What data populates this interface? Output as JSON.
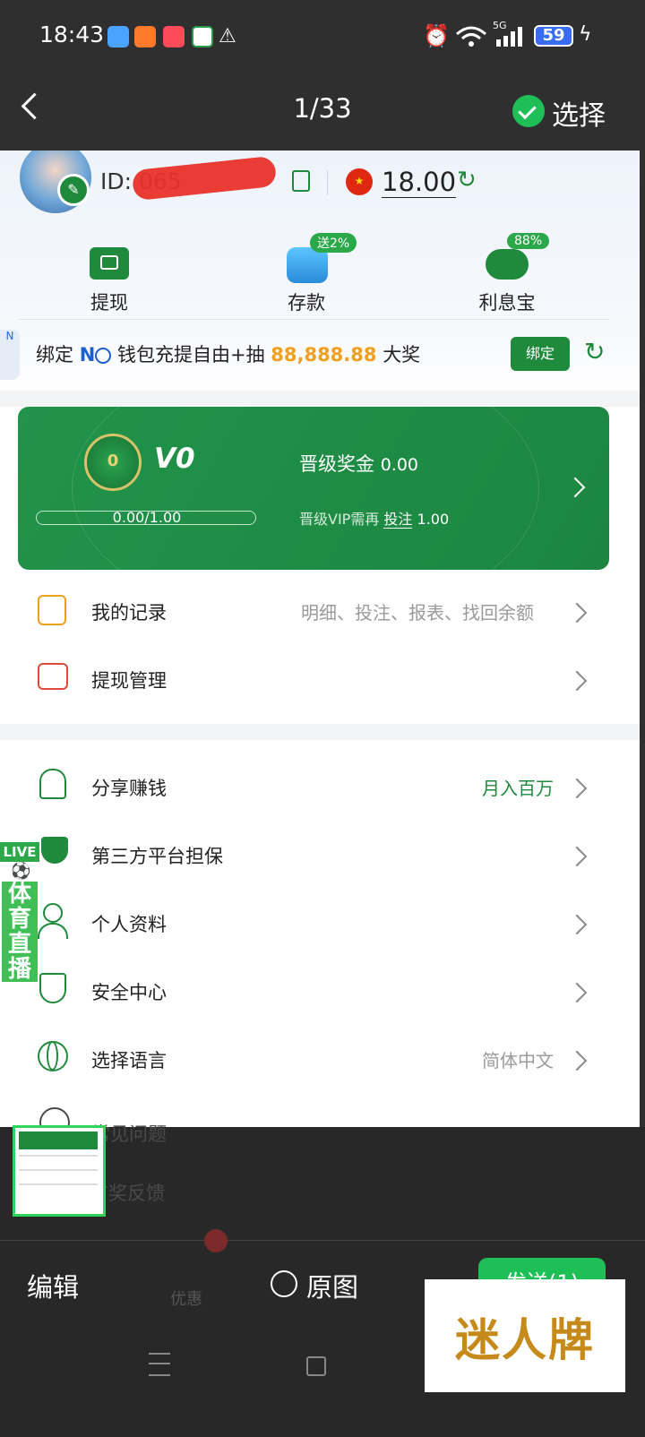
{
  "status": {
    "time": "18:43",
    "signal": "5G",
    "battery": "59"
  },
  "topbar": {
    "counter": "1/33",
    "select_label": "选择"
  },
  "profile": {
    "id_suffix": "ID: 065",
    "balance": "18.00"
  },
  "quick_actions": [
    {
      "label": "提现",
      "badge": ""
    },
    {
      "label": "存款",
      "badge": "送2%"
    },
    {
      "label": "利息宝",
      "badge": "88%"
    }
  ],
  "bind_banner": {
    "text_prefix": "绑定",
    "brand": "N",
    "text_mid": "钱包充提自由+抽",
    "amount": "88,888.88",
    "text_suffix": "大奖",
    "button": "绑定",
    "side_tag": "N"
  },
  "vip_card": {
    "level_badge": "0",
    "level": "V0",
    "progress_text": "0.00/1.00",
    "progress_fraction": 0.0,
    "bonus_label": "晋级奖金",
    "bonus_value": "0.00",
    "need_prefix": "晋级VIP需再",
    "need_action": "投注",
    "need_value": "1.00"
  },
  "menu1": [
    {
      "label": "我的记录",
      "value": "明细、投注、报表、找回余额",
      "icon": "record-icon"
    },
    {
      "label": "提现管理",
      "value": "",
      "icon": "withdraw-manage-icon"
    }
  ],
  "menu2": [
    {
      "label": "分享赚钱",
      "value": "月入百万",
      "icon": "share-icon"
    },
    {
      "label": "第三方平台担保",
      "value": "",
      "icon": "guarantee-icon"
    },
    {
      "label": "个人资料",
      "value": "",
      "icon": "profile-icon"
    },
    {
      "label": "安全中心",
      "value": "",
      "icon": "shield-icon"
    },
    {
      "label": "选择语言",
      "value": "简体中文",
      "icon": "globe-icon"
    },
    {
      "label": "常见问题",
      "value": "",
      "icon": "question-icon"
    },
    {
      "label": "有奖反馈",
      "value": "",
      "icon": "feedback-icon"
    }
  ],
  "live_tag": {
    "live": "LIVE",
    "text": "体育直播"
  },
  "bottom_nav": [
    {
      "label": "优惠"
    }
  ],
  "picker_bar": {
    "edit": "编辑",
    "original": "原图",
    "send": "发送(1)"
  },
  "watermark": "迷人牌",
  "colors": {
    "brand_green": "#1f8a3c",
    "amount_orange": "#f0a020",
    "dark_bar": "#2f2f2f"
  }
}
